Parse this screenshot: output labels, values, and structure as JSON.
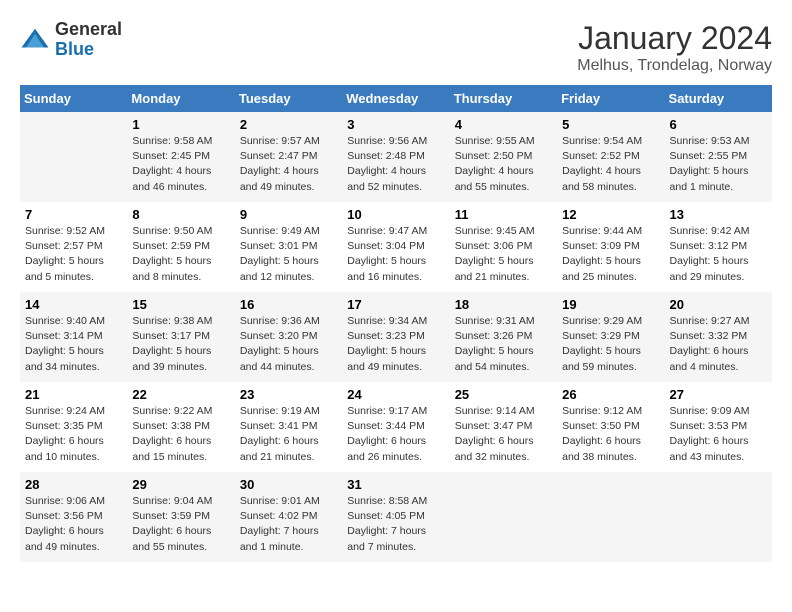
{
  "logo": {
    "general": "General",
    "blue": "Blue"
  },
  "title": "January 2024",
  "location": "Melhus, Trondelag, Norway",
  "headers": [
    "Sunday",
    "Monday",
    "Tuesday",
    "Wednesday",
    "Thursday",
    "Friday",
    "Saturday"
  ],
  "weeks": [
    [
      {
        "day": "",
        "info": ""
      },
      {
        "day": "1",
        "info": "Sunrise: 9:58 AM\nSunset: 2:45 PM\nDaylight: 4 hours\nand 46 minutes."
      },
      {
        "day": "2",
        "info": "Sunrise: 9:57 AM\nSunset: 2:47 PM\nDaylight: 4 hours\nand 49 minutes."
      },
      {
        "day": "3",
        "info": "Sunrise: 9:56 AM\nSunset: 2:48 PM\nDaylight: 4 hours\nand 52 minutes."
      },
      {
        "day": "4",
        "info": "Sunrise: 9:55 AM\nSunset: 2:50 PM\nDaylight: 4 hours\nand 55 minutes."
      },
      {
        "day": "5",
        "info": "Sunrise: 9:54 AM\nSunset: 2:52 PM\nDaylight: 4 hours\nand 58 minutes."
      },
      {
        "day": "6",
        "info": "Sunrise: 9:53 AM\nSunset: 2:55 PM\nDaylight: 5 hours\nand 1 minute."
      }
    ],
    [
      {
        "day": "7",
        "info": "Sunrise: 9:52 AM\nSunset: 2:57 PM\nDaylight: 5 hours\nand 5 minutes."
      },
      {
        "day": "8",
        "info": "Sunrise: 9:50 AM\nSunset: 2:59 PM\nDaylight: 5 hours\nand 8 minutes."
      },
      {
        "day": "9",
        "info": "Sunrise: 9:49 AM\nSunset: 3:01 PM\nDaylight: 5 hours\nand 12 minutes."
      },
      {
        "day": "10",
        "info": "Sunrise: 9:47 AM\nSunset: 3:04 PM\nDaylight: 5 hours\nand 16 minutes."
      },
      {
        "day": "11",
        "info": "Sunrise: 9:45 AM\nSunset: 3:06 PM\nDaylight: 5 hours\nand 21 minutes."
      },
      {
        "day": "12",
        "info": "Sunrise: 9:44 AM\nSunset: 3:09 PM\nDaylight: 5 hours\nand 25 minutes."
      },
      {
        "day": "13",
        "info": "Sunrise: 9:42 AM\nSunset: 3:12 PM\nDaylight: 5 hours\nand 29 minutes."
      }
    ],
    [
      {
        "day": "14",
        "info": "Sunrise: 9:40 AM\nSunset: 3:14 PM\nDaylight: 5 hours\nand 34 minutes."
      },
      {
        "day": "15",
        "info": "Sunrise: 9:38 AM\nSunset: 3:17 PM\nDaylight: 5 hours\nand 39 minutes."
      },
      {
        "day": "16",
        "info": "Sunrise: 9:36 AM\nSunset: 3:20 PM\nDaylight: 5 hours\nand 44 minutes."
      },
      {
        "day": "17",
        "info": "Sunrise: 9:34 AM\nSunset: 3:23 PM\nDaylight: 5 hours\nand 49 minutes."
      },
      {
        "day": "18",
        "info": "Sunrise: 9:31 AM\nSunset: 3:26 PM\nDaylight: 5 hours\nand 54 minutes."
      },
      {
        "day": "19",
        "info": "Sunrise: 9:29 AM\nSunset: 3:29 PM\nDaylight: 5 hours\nand 59 minutes."
      },
      {
        "day": "20",
        "info": "Sunrise: 9:27 AM\nSunset: 3:32 PM\nDaylight: 6 hours\nand 4 minutes."
      }
    ],
    [
      {
        "day": "21",
        "info": "Sunrise: 9:24 AM\nSunset: 3:35 PM\nDaylight: 6 hours\nand 10 minutes."
      },
      {
        "day": "22",
        "info": "Sunrise: 9:22 AM\nSunset: 3:38 PM\nDaylight: 6 hours\nand 15 minutes."
      },
      {
        "day": "23",
        "info": "Sunrise: 9:19 AM\nSunset: 3:41 PM\nDaylight: 6 hours\nand 21 minutes."
      },
      {
        "day": "24",
        "info": "Sunrise: 9:17 AM\nSunset: 3:44 PM\nDaylight: 6 hours\nand 26 minutes."
      },
      {
        "day": "25",
        "info": "Sunrise: 9:14 AM\nSunset: 3:47 PM\nDaylight: 6 hours\nand 32 minutes."
      },
      {
        "day": "26",
        "info": "Sunrise: 9:12 AM\nSunset: 3:50 PM\nDaylight: 6 hours\nand 38 minutes."
      },
      {
        "day": "27",
        "info": "Sunrise: 9:09 AM\nSunset: 3:53 PM\nDaylight: 6 hours\nand 43 minutes."
      }
    ],
    [
      {
        "day": "28",
        "info": "Sunrise: 9:06 AM\nSunset: 3:56 PM\nDaylight: 6 hours\nand 49 minutes."
      },
      {
        "day": "29",
        "info": "Sunrise: 9:04 AM\nSunset: 3:59 PM\nDaylight: 6 hours\nand 55 minutes."
      },
      {
        "day": "30",
        "info": "Sunrise: 9:01 AM\nSunset: 4:02 PM\nDaylight: 7 hours\nand 1 minute."
      },
      {
        "day": "31",
        "info": "Sunrise: 8:58 AM\nSunset: 4:05 PM\nDaylight: 7 hours\nand 7 minutes."
      },
      {
        "day": "",
        "info": ""
      },
      {
        "day": "",
        "info": ""
      },
      {
        "day": "",
        "info": ""
      }
    ]
  ]
}
